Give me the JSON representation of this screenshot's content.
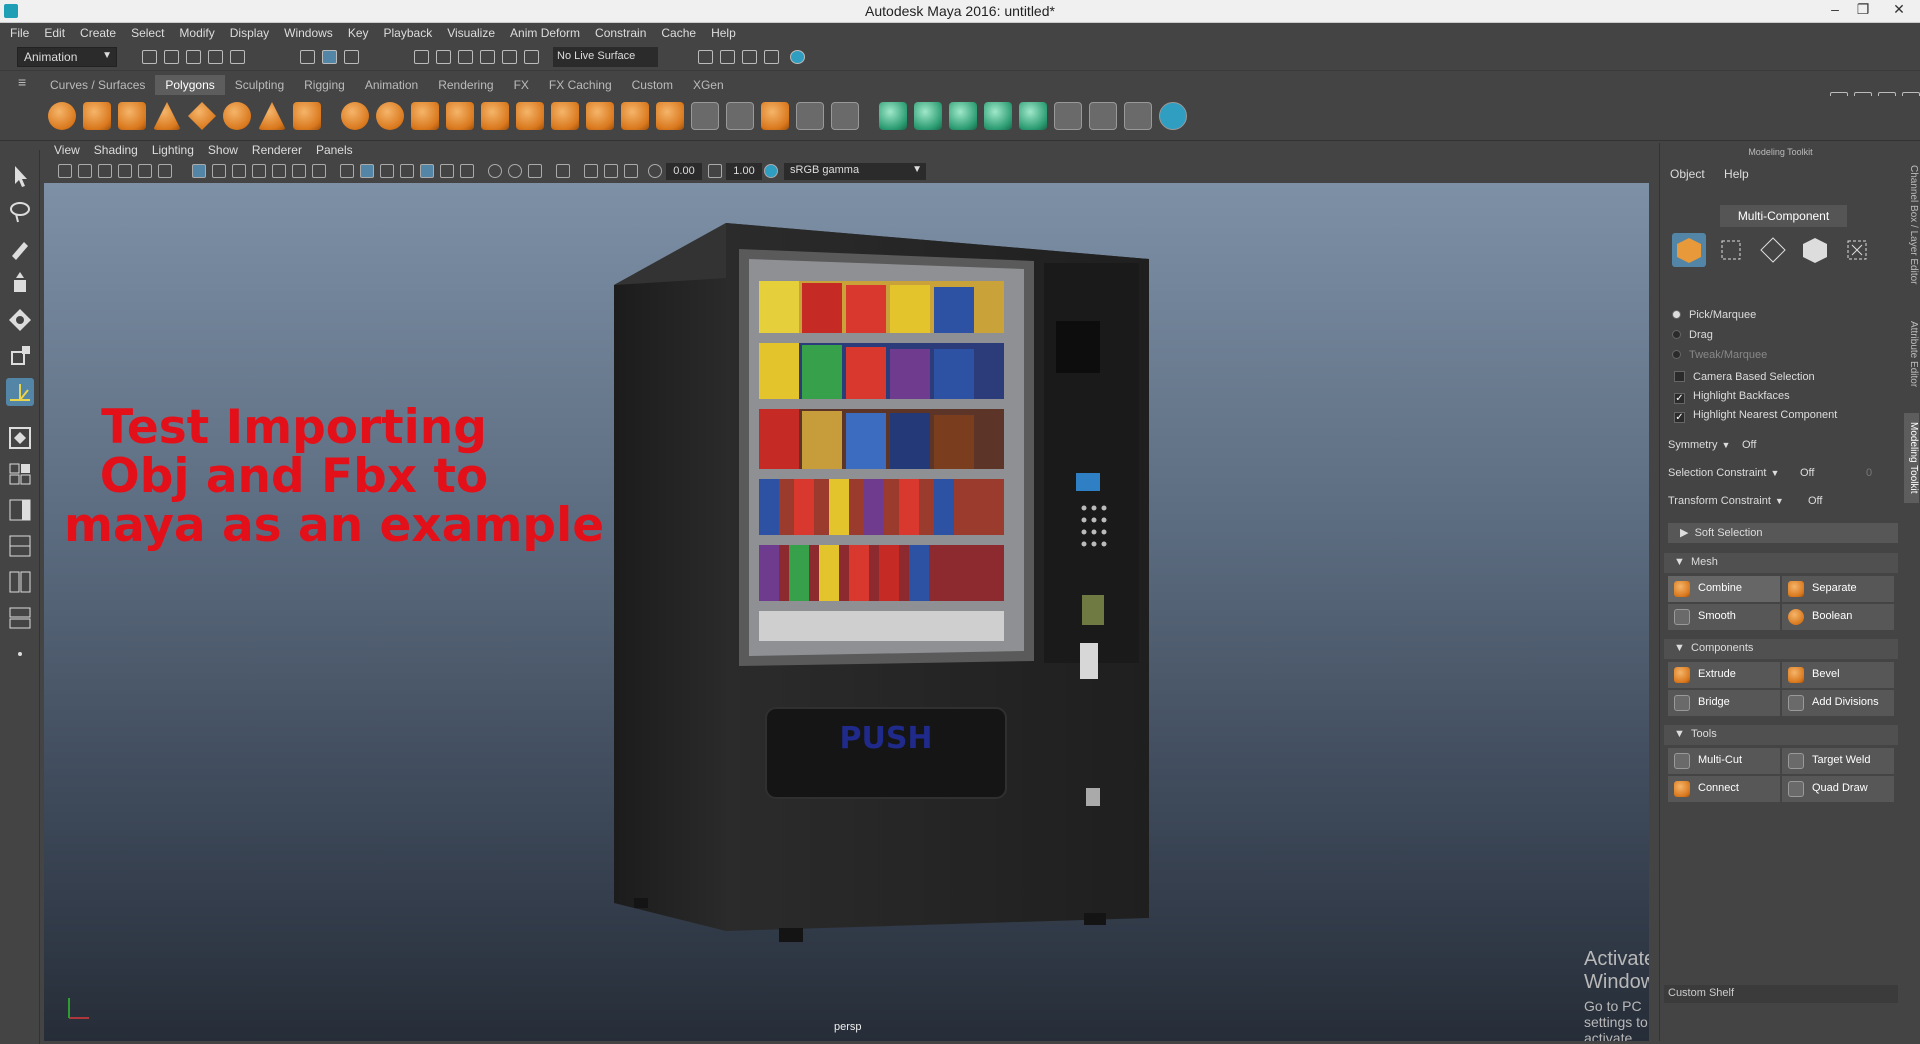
{
  "window": {
    "title": "Autodesk Maya 2016: untitled*",
    "minimize": "–",
    "restore": "❐",
    "close": "✕"
  },
  "menubar": [
    "File",
    "Edit",
    "Create",
    "Select",
    "Modify",
    "Display",
    "Windows",
    "Key",
    "Playback",
    "Visualize",
    "Anim Deform",
    "Constrain",
    "Cache",
    "Help"
  ],
  "statusline": {
    "mode": "Animation",
    "live_surface": "No Live Surface"
  },
  "shelf_tabs": [
    "Curves / Surfaces",
    "Polygons",
    "Sculpting",
    "Rigging",
    "Animation",
    "Rendering",
    "FX",
    "FX Caching",
    "Custom",
    "XGen"
  ],
  "shelf_active_tab": "Polygons",
  "viewport": {
    "menu": [
      "View",
      "Shading",
      "Lighting",
      "Show",
      "Renderer",
      "Panels"
    ],
    "field_a": "0.00",
    "field_b": "1.00",
    "color_space": "sRGB gamma",
    "camera_label": "persp",
    "overlay_line1": "Test Importing",
    "overlay_line2": "Obj and Fbx to",
    "overlay_line3": "maya as an example",
    "push_label": "PUSH",
    "activate_line1": "Activate Windows",
    "activate_line2": "Go to PC settings to activate Windows."
  },
  "toolkit": {
    "title": "Modeling Toolkit",
    "menu": [
      "Object",
      "Help"
    ],
    "multi_component": "Multi-Component",
    "pick_marquee": "Pick/Marquee",
    "drag": "Drag",
    "tweak_marquee": "Tweak/Marquee",
    "camera_based": "Camera Based Selection",
    "highlight_backfaces": "Highlight Backfaces",
    "highlight_nearest": "Highlight Nearest Component",
    "symmetry_label": "Symmetry",
    "symmetry_value": "Off",
    "selection_constraint_label": "Selection Constraint",
    "selection_constraint_value": "Off",
    "selection_constraint_num": "0",
    "transform_constraint_label": "Transform Constraint",
    "transform_constraint_value": "Off",
    "soft_selection": "Soft Selection",
    "mesh_section": "Mesh",
    "combine": "Combine",
    "separate": "Separate",
    "smooth": "Smooth",
    "boolean": "Boolean",
    "components_section": "Components",
    "extrude": "Extrude",
    "bevel": "Bevel",
    "bridge": "Bridge",
    "add_divisions": "Add Divisions",
    "tools_section": "Tools",
    "multi_cut": "Multi-Cut",
    "target_weld": "Target Weld",
    "connect": "Connect",
    "quad_draw": "Quad Draw",
    "custom_shelf": "Custom Shelf"
  },
  "side_tabs": [
    "Channel Box / Layer Editor",
    "Attribute Editor",
    "Modeling Toolkit"
  ],
  "colors": {
    "accent": "#5285a6",
    "overlay_text": "#e3101a",
    "panel_bg": "#444444"
  }
}
